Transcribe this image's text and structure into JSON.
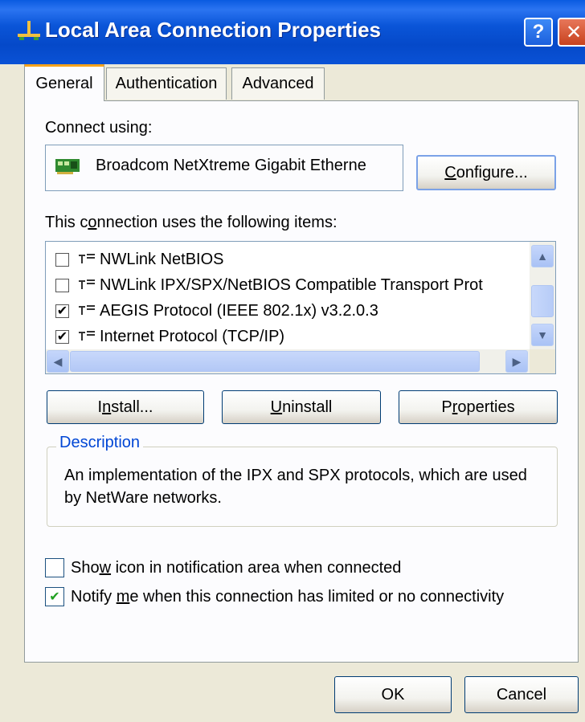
{
  "window": {
    "title": "Local Area Connection Properties",
    "help_glyph": "?",
    "close_glyph": "✕"
  },
  "tabs": [
    {
      "label": "General",
      "selected": true
    },
    {
      "label": "Authentication",
      "selected": false
    },
    {
      "label": "Advanced",
      "selected": false
    }
  ],
  "general": {
    "connect_using_label": "Connect using:",
    "adapter_name": "Broadcom NetXtreme Gigabit Etherne",
    "configure_button": {
      "pre": "",
      "accel": "C",
      "post": "onfigure..."
    },
    "items_label": {
      "pre": "This c",
      "accel": "o",
      "post": "nnection uses the following items:"
    },
    "items": [
      {
        "label": "NWLink NetBIOS",
        "checked": false
      },
      {
        "label": "NWLink IPX/SPX/NetBIOS Compatible Transport Prot",
        "checked": false
      },
      {
        "label": "AEGIS Protocol (IEEE 802.1x) v3.2.0.3",
        "checked": true
      },
      {
        "label": "Internet Protocol (TCP/IP)",
        "checked": true
      }
    ],
    "install_button": {
      "pre": "I",
      "accel": "n",
      "post": "stall..."
    },
    "uninstall_button": {
      "pre": "",
      "accel": "U",
      "post": "ninstall"
    },
    "properties_button": {
      "pre": "P",
      "accel": "r",
      "post": "operties"
    },
    "description_title": "Description",
    "description_text": "An implementation of the IPX and SPX protocols, which are used by NetWare networks.",
    "show_icon_option": {
      "pre": "Sho",
      "accel": "w",
      "post": " icon in notification area when connected",
      "checked": false
    },
    "notify_option": {
      "pre": "Notify ",
      "accel": "m",
      "post": "e when this connection has limited or no connectivity",
      "checked": true
    }
  },
  "footer": {
    "ok_label": "OK",
    "cancel_label": "Cancel"
  },
  "icons": {
    "check_glyph": "✔",
    "scroll_up": "▲",
    "scroll_down": "▼",
    "scroll_left": "◀",
    "scroll_right": "▶"
  },
  "colors": {
    "titlebar": "#0a55d8",
    "dialog_bg": "#ece9d8",
    "group_title": "#0046d5"
  }
}
